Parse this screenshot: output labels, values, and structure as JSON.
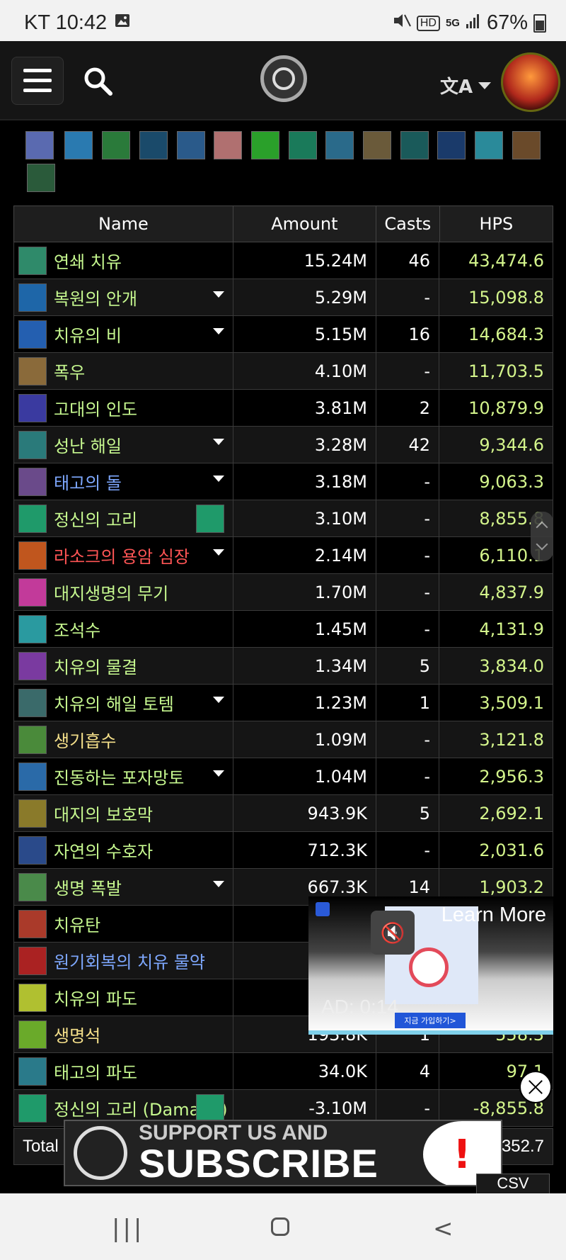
{
  "status_bar": {
    "carrier_time": "KT 10:42",
    "battery": "67%"
  },
  "nav": {
    "lang_icon": "translate-icon"
  },
  "table": {
    "headers": {
      "name": "Name",
      "amount": "Amount",
      "casts": "Casts",
      "hps": "HPS"
    },
    "rows": [
      {
        "name": "연쇄 치유",
        "amount": "15.24M",
        "casts": "46",
        "hps": "43,474.6",
        "color": "#c6f88f",
        "icon": "#2f8a6a",
        "dropdown": false
      },
      {
        "name": "복원의 안개",
        "amount": "5.29M",
        "casts": "-",
        "hps": "15,098.8",
        "color": "#c6f88f",
        "icon": "#1e66a8",
        "dropdown": true
      },
      {
        "name": "치유의 비",
        "amount": "5.15M",
        "casts": "16",
        "hps": "14,684.3",
        "color": "#c6f88f",
        "icon": "#245fb0",
        "dropdown": true
      },
      {
        "name": "폭우",
        "amount": "4.10M",
        "casts": "-",
        "hps": "11,703.5",
        "color": "#c6f88f",
        "icon": "#8a6a3a",
        "dropdown": false
      },
      {
        "name": "고대의 인도",
        "amount": "3.81M",
        "casts": "2",
        "hps": "10,879.9",
        "color": "#c6f88f",
        "icon": "#3a3aa0",
        "dropdown": false
      },
      {
        "name": "성난 해일",
        "amount": "3.28M",
        "casts": "42",
        "hps": "9,344.6",
        "color": "#c6f88f",
        "icon": "#2a7a7a",
        "dropdown": true
      },
      {
        "name": "태고의 돌",
        "amount": "3.18M",
        "casts": "-",
        "hps": "9,063.3",
        "color": "#7ea8ff",
        "icon": "#6a4a8a",
        "dropdown": true
      },
      {
        "name": "정신의 고리",
        "amount": "3.10M",
        "casts": "-",
        "hps": "8,855.8",
        "color": "#c6f88f",
        "icon": "#1f9a6a",
        "dropdown": false,
        "mini_icon": true
      },
      {
        "name": "라소크의 용암 심장",
        "amount": "2.14M",
        "casts": "-",
        "hps": "6,110.1",
        "color": "#ff5555",
        "icon": "#c0561e",
        "dropdown": true
      },
      {
        "name": "대지생명의 무기",
        "amount": "1.70M",
        "casts": "-",
        "hps": "4,837.9",
        "color": "#c6f88f",
        "icon": "#c23a9a",
        "dropdown": false
      },
      {
        "name": "조석수",
        "amount": "1.45M",
        "casts": "-",
        "hps": "4,131.9",
        "color": "#c6f88f",
        "icon": "#2a9aa0",
        "dropdown": false
      },
      {
        "name": "치유의 물결",
        "amount": "1.34M",
        "casts": "5",
        "hps": "3,834.0",
        "color": "#c6f88f",
        "icon": "#7a3aa0",
        "dropdown": false
      },
      {
        "name": "치유의 해일 토템",
        "amount": "1.23M",
        "casts": "1",
        "hps": "3,509.1",
        "color": "#c6f88f",
        "icon": "#3a6a6a",
        "dropdown": true
      },
      {
        "name": "생기흡수",
        "amount": "1.09M",
        "casts": "-",
        "hps": "3,121.8",
        "color": "#f5e08a",
        "icon": "#4a8a3a",
        "dropdown": false
      },
      {
        "name": "진동하는 포자망토",
        "amount": "1.04M",
        "casts": "-",
        "hps": "2,956.3",
        "color": "#c6f88f",
        "icon": "#2a6aa8",
        "dropdown": true
      },
      {
        "name": "대지의 보호막",
        "amount": "943.9K",
        "casts": "5",
        "hps": "2,692.1",
        "color": "#c6f88f",
        "icon": "#8a7a2a",
        "dropdown": false
      },
      {
        "name": "자연의 수호자",
        "amount": "712.3K",
        "casts": "-",
        "hps": "2,031.6",
        "color": "#c6f88f",
        "icon": "#2a4a8a",
        "dropdown": false
      },
      {
        "name": "생명 폭발",
        "amount": "667.3K",
        "casts": "14",
        "hps": "1,903.2",
        "color": "#c6f88f",
        "icon": "#4a8a4a",
        "dropdown": true
      },
      {
        "name": "치유탄",
        "amount": "",
        "casts": "",
        "hps": "",
        "color": "#c6f88f",
        "icon": "#aa3a2a",
        "dropdown": false
      },
      {
        "name": "원기회복의 치유 물약",
        "amount": "",
        "casts": "",
        "hps": "",
        "color": "#7ea8ff",
        "icon": "#aa2222",
        "dropdown": false
      },
      {
        "name": "치유의 파도",
        "amount": "",
        "casts": "",
        "hps": "",
        "color": "#c6f88f",
        "icon": "#b0c030",
        "dropdown": false
      },
      {
        "name": "생명석",
        "amount": "193.8K",
        "casts": "1",
        "hps": "558.3",
        "color": "#f5e08a",
        "icon": "#6aaa2a",
        "dropdown": false
      },
      {
        "name": "태고의 파도",
        "amount": "34.0K",
        "casts": "4",
        "hps": "97.1",
        "color": "#c6f88f",
        "icon": "#2a7a8a",
        "dropdown": false
      },
      {
        "name": "정신의 고리 (Damage)",
        "amount": "-3.10M",
        "casts": "-",
        "hps": "-8,855.8",
        "color": "#c6f88f",
        "icon": "#1f9a6a",
        "dropdown": false,
        "mini_icon": true
      }
    ],
    "total": {
      "label": "Total",
      "hps": "352.7"
    }
  },
  "ad": {
    "learn_more": "Learn More",
    "timer": "AD: 0:14",
    "cta": "지금 가입하기>"
  },
  "banner": {
    "line1": "SUPPORT US AND",
    "line2": "SUBSCRIBE",
    "mark": "!"
  },
  "csv": "CSV",
  "icons": [
    "menu-icon",
    "search-icon",
    "logo-icon",
    "avatar"
  ]
}
